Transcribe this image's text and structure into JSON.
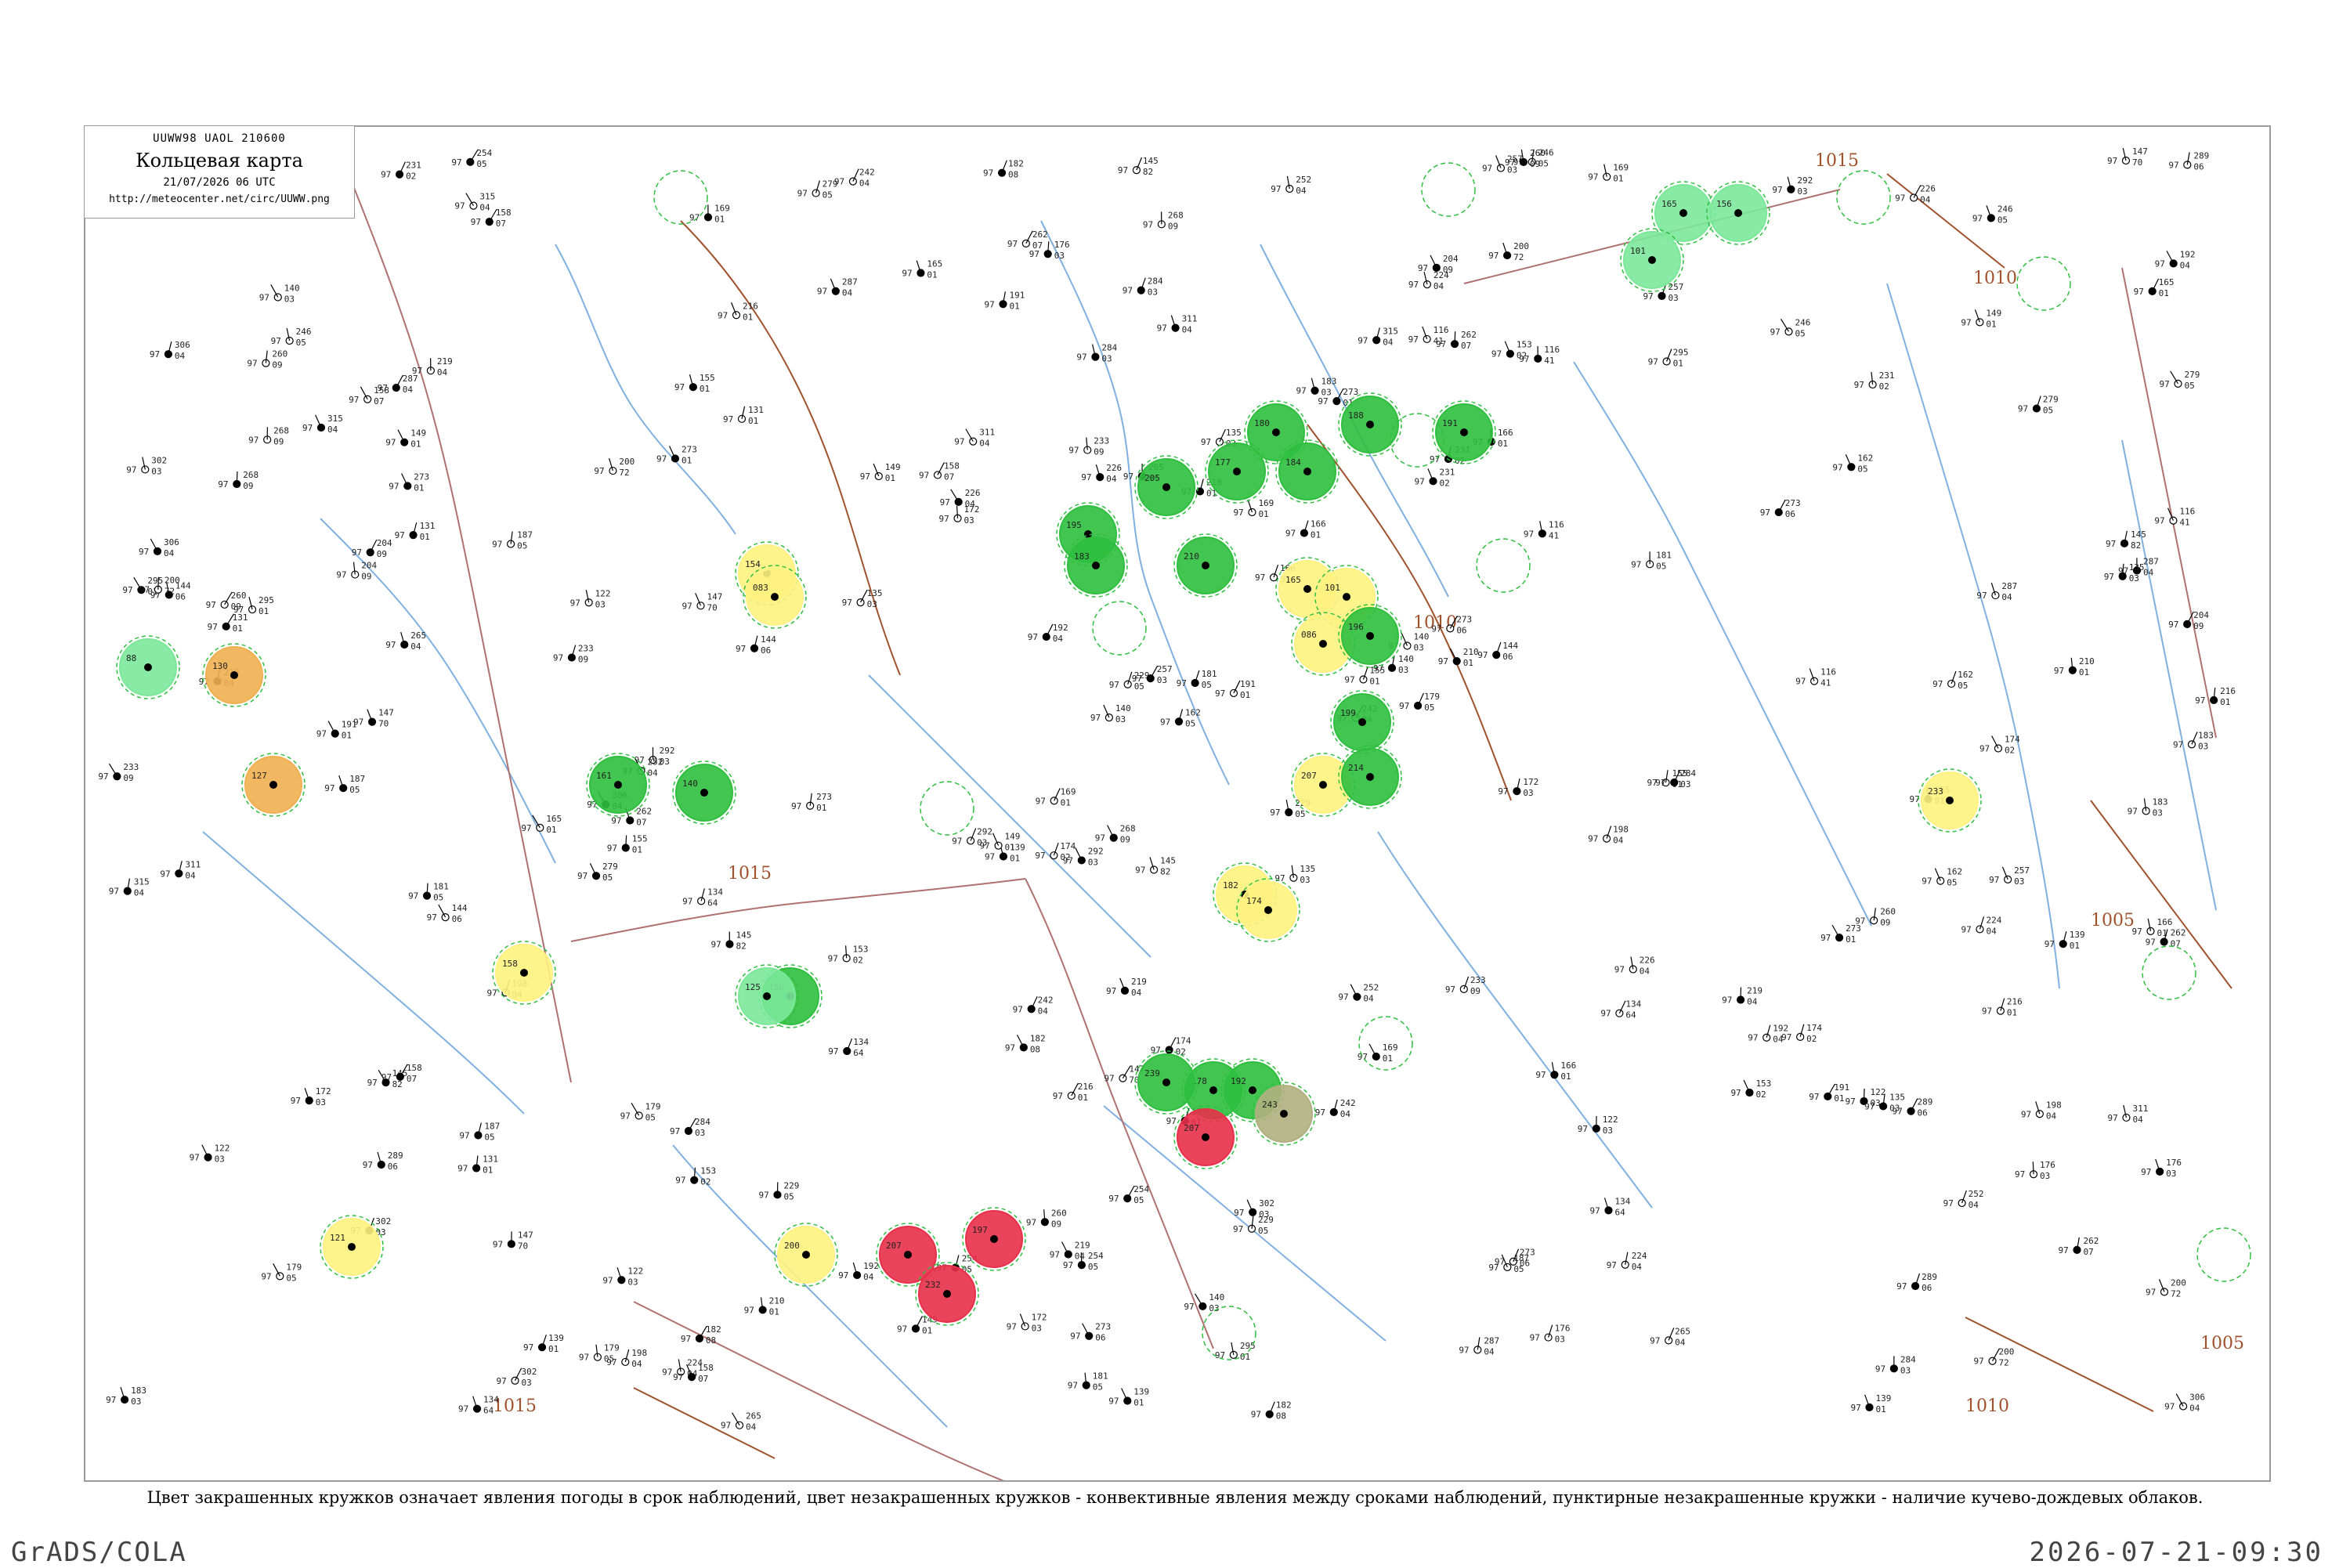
{
  "header": {
    "code_line": "UUWW98  UAOL  210600",
    "title": "Кольцевая карта",
    "date_line": "21/07/2026 06 UTC",
    "url": "http://meteocenter.net/circ/UUWW.png"
  },
  "caption": "Цвет закрашенных кружков означает явления погоды в срок наблюдений, цвет незакрашенных кружков - конвективные явления между сроками наблюдений, пунктирные незакрашенные кружки - наличие кучево-дождевых облаков.",
  "footer": {
    "software": "GrADS/COLA",
    "timestamp": "2026-07-21-09:30"
  },
  "isobars": [
    "1015",
    "1010",
    "1005",
    "1010",
    "1015",
    "1005",
    "1010",
    "1005",
    "1015"
  ],
  "colors": {
    "rain": "#2fbf3f",
    "light_rain": "#7be89a",
    "thunder": "#e8304a",
    "fog_haze": "#fff280",
    "smoke": "#f0b050",
    "dust": "#b0b080",
    "isobar": "#a0522d",
    "rivers": "#7fb0e0",
    "borders": "#b07070"
  },
  "stations": [
    {
      "p": "145",
      "t": "97",
      "n": "82"
    },
    {
      "p": "169",
      "t": "97",
      "n": "01"
    },
    {
      "p": "155",
      "t": "97",
      "n": "01"
    },
    {
      "p": "200",
      "t": "97",
      "n": "72"
    },
    {
      "p": "116",
      "t": "97",
      "n": "41"
    },
    {
      "p": "158",
      "t": "97",
      "n": "07"
    },
    {
      "p": "147",
      "t": "97",
      "n": "70"
    },
    {
      "p": "139",
      "t": "97",
      "n": "01"
    },
    {
      "p": "134",
      "t": "97",
      "n": "64"
    },
    {
      "p": "166",
      "t": "97",
      "n": "01"
    },
    {
      "p": "135",
      "t": "97",
      "n": "03"
    },
    {
      "p": "122",
      "t": "97",
      "n": "03"
    },
    {
      "p": "140",
      "t": "97",
      "n": "03"
    },
    {
      "p": "149",
      "t": "97",
      "n": "01"
    },
    {
      "p": "219",
      "t": "97",
      "n": "04"
    },
    {
      "p": "287",
      "t": "97",
      "n": "04"
    },
    {
      "p": "260",
      "t": "97",
      "n": "09"
    },
    {
      "p": "273",
      "t": "97",
      "n": "01"
    },
    {
      "p": "284",
      "t": "97",
      "n": "03"
    },
    {
      "p": "262",
      "t": "97",
      "n": "07"
    },
    {
      "p": "252",
      "t": "97",
      "n": "04"
    },
    {
      "p": "233",
      "t": "97",
      "n": "09"
    },
    {
      "p": "224",
      "t": "97",
      "n": "04"
    },
    {
      "p": "242",
      "t": "97",
      "n": "04"
    },
    {
      "p": "254",
      "t": "97",
      "n": "05"
    },
    {
      "p": "289",
      "t": "97",
      "n": "06"
    },
    {
      "p": "306",
      "t": "97",
      "n": "04"
    },
    {
      "p": "273",
      "t": "97",
      "n": "06"
    },
    {
      "p": "315",
      "t": "97",
      "n": "04"
    },
    {
      "p": "302",
      "t": "97",
      "n": "03"
    },
    {
      "p": "268",
      "t": "97",
      "n": "09"
    },
    {
      "p": "295",
      "t": "97",
      "n": "01"
    },
    {
      "p": "246",
      "t": "97",
      "n": "05"
    },
    {
      "p": "204",
      "t": "97",
      "n": "09"
    },
    {
      "p": "229",
      "t": "97",
      "n": "05"
    },
    {
      "p": "216",
      "t": "97",
      "n": "01"
    },
    {
      "p": "226",
      "t": "97",
      "n": "04"
    },
    {
      "p": "179",
      "t": "97",
      "n": "05"
    },
    {
      "p": "187",
      "t": "97",
      "n": "05"
    },
    {
      "p": "192",
      "t": "97",
      "n": "04"
    },
    {
      "p": "191",
      "t": "97",
      "n": "01"
    },
    {
      "p": "172",
      "t": "97",
      "n": "03"
    },
    {
      "p": "181",
      "t": "97",
      "n": "05"
    },
    {
      "p": "174",
      "t": "97",
      "n": "02"
    },
    {
      "p": "182",
      "t": "97",
      "n": "08"
    },
    {
      "p": "176",
      "t": "97",
      "n": "03"
    },
    {
      "p": "144",
      "t": "97",
      "n": "06"
    },
    {
      "p": "162",
      "t": "97",
      "n": "05"
    },
    {
      "p": "131",
      "t": "97",
      "n": "01"
    },
    {
      "p": "153",
      "t": "97",
      "n": "02"
    },
    {
      "p": "165",
      "t": "97",
      "n": "01"
    },
    {
      "p": "183",
      "t": "97",
      "n": "03"
    },
    {
      "p": "198",
      "t": "97",
      "n": "04"
    },
    {
      "p": "210",
      "t": "97",
      "n": "01"
    },
    {
      "p": "231",
      "t": "97",
      "n": "02"
    },
    {
      "p": "257",
      "t": "97",
      "n": "03"
    },
    {
      "p": "265",
      "t": "97",
      "n": "04"
    },
    {
      "p": "279",
      "t": "97",
      "n": "05"
    },
    {
      "p": "292",
      "t": "97",
      "n": "03"
    },
    {
      "p": "311",
      "t": "97",
      "n": "04"
    }
  ],
  "circles": [
    {
      "label": "165",
      "kind": "light_rain"
    },
    {
      "label": "156",
      "kind": "light_rain"
    },
    {
      "label": "101",
      "kind": "light_rain"
    },
    {
      "label": "180",
      "kind": "rain"
    },
    {
      "label": "177",
      "kind": "rain"
    },
    {
      "label": "184",
      "kind": "rain"
    },
    {
      "label": "205",
      "kind": "rain"
    },
    {
      "label": "195",
      "kind": "rain"
    },
    {
      "label": "183",
      "kind": "rain"
    },
    {
      "label": "210",
      "kind": "rain"
    },
    {
      "label": "188",
      "kind": "rain"
    },
    {
      "label": "191",
      "kind": "rain"
    },
    {
      "label": "154",
      "kind": "fog_haze"
    },
    {
      "label": "083",
      "kind": "fog_haze"
    },
    {
      "label": "165",
      "kind": "fog_haze"
    },
    {
      "label": "101",
      "kind": "fog_haze"
    },
    {
      "label": "086",
      "kind": "fog_haze"
    },
    {
      "label": "207",
      "kind": "fog_haze"
    },
    {
      "label": "182",
      "kind": "fog_haze"
    },
    {
      "label": "174",
      "kind": "fog_haze"
    },
    {
      "label": "158",
      "kind": "fog_haze"
    },
    {
      "label": "121",
      "kind": "fog_haze"
    },
    {
      "label": "200",
      "kind": "fog_haze"
    },
    {
      "label": "233",
      "kind": "fog_haze"
    },
    {
      "label": "130",
      "kind": "smoke"
    },
    {
      "label": "127",
      "kind": "smoke"
    },
    {
      "label": "88",
      "kind": "light_rain"
    },
    {
      "label": "156",
      "kind": "rain"
    },
    {
      "label": "161",
      "kind": "rain"
    },
    {
      "label": "140",
      "kind": "rain"
    },
    {
      "label": "125",
      "kind": "light_rain"
    },
    {
      "label": "178",
      "kind": "rain"
    },
    {
      "label": "192",
      "kind": "rain"
    },
    {
      "label": "207",
      "kind": "thunder"
    },
    {
      "label": "232",
      "kind": "thunder"
    },
    {
      "label": "197",
      "kind": "thunder"
    },
    {
      "label": "207",
      "kind": "thunder"
    },
    {
      "label": "239",
      "kind": "rain"
    },
    {
      "label": "243",
      "kind": "dust"
    },
    {
      "label": "196",
      "kind": "rain"
    },
    {
      "label": "199",
      "kind": "rain"
    },
    {
      "label": "214",
      "kind": "rain"
    }
  ]
}
